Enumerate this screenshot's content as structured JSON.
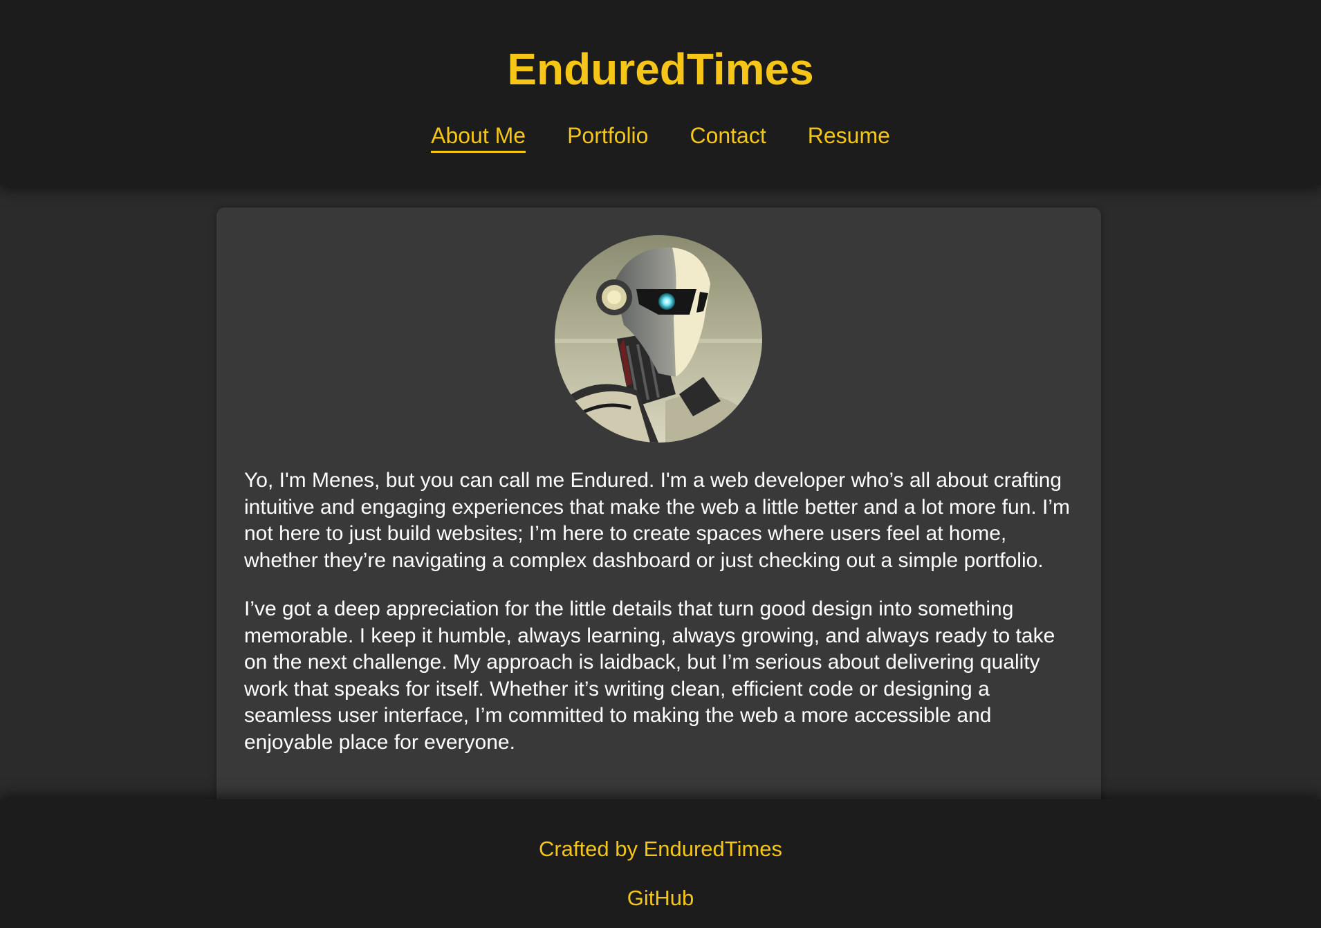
{
  "header": {
    "title": "EnduredTimes",
    "nav": [
      {
        "label": "About Me",
        "active": true
      },
      {
        "label": "Portfolio"
      },
      {
        "label": "Contact"
      },
      {
        "label": "Resume"
      }
    ]
  },
  "about": {
    "avatar_icon": "robot-avatar",
    "paragraphs": [
      "Yo, I'm Menes, but you can call me Endured. I'm a web developer who’s all about crafting intuitive and engaging experiences that make the web a little better and a lot more fun. I’m not here to just build websites; I’m here to create spaces where users feel at home, whether they’re navigating a complex dashboard or just checking out a simple portfolio.",
      "I’ve got a deep appreciation for the little details that turn good design into something memorable. I keep it humble, always learning, always growing, and always ready to take on the next challenge. My approach is laidback, but I’m serious about delivering quality work that speaks for itself. Whether it’s writing clean, efficient code or designing a seamless user interface, I’m committed to making the web a more accessible and enjoyable place for everyone."
    ]
  },
  "footer": {
    "credit": "Crafted by EnduredTimes",
    "github_label": "GitHub"
  },
  "colors": {
    "accent": "#f5c518",
    "header_bg": "#1c1c1c",
    "page_bg": "#2b2b2b",
    "card_bg": "#393939",
    "text": "#ffffff"
  }
}
